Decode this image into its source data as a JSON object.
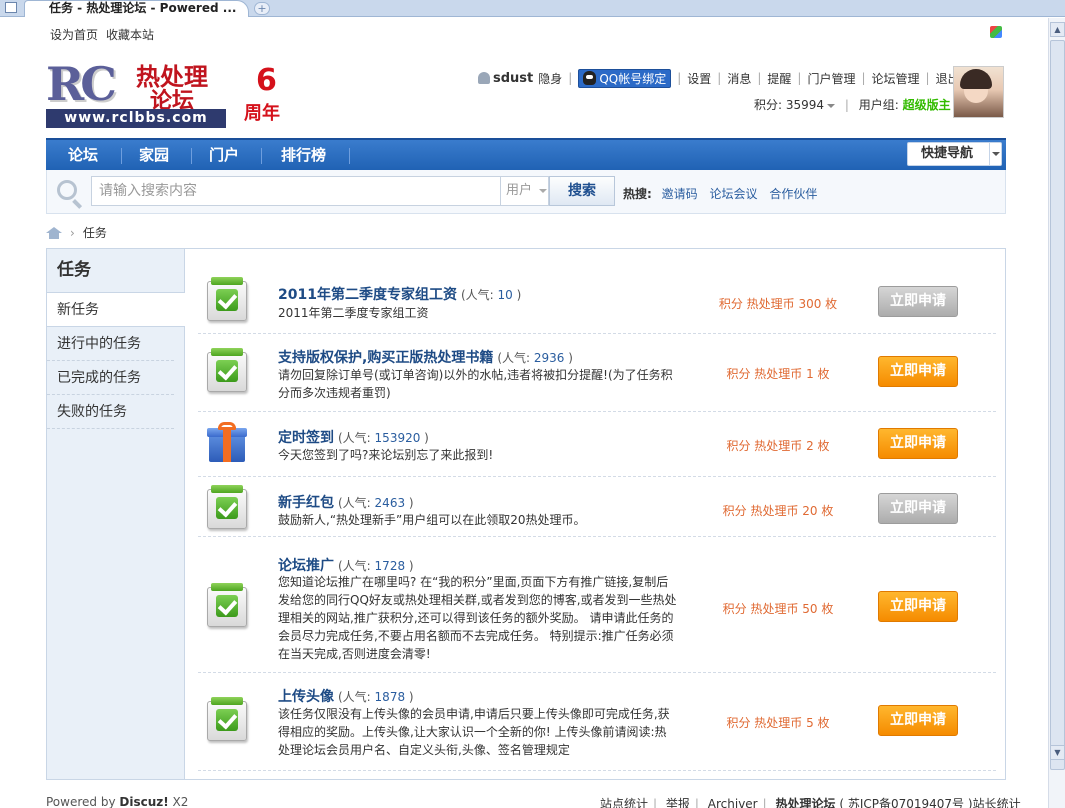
{
  "browser": {
    "tab_title": "任务 - 热处理论坛 - Powered ...",
    "newtab_label": "+"
  },
  "topbar": {
    "set_home": "设为首页",
    "bookmark": "收藏本站"
  },
  "logo": {
    "brand_letters": "RC",
    "cn_line1": "热处理",
    "cn_line2": "论坛",
    "url": "www.rclbbs.com",
    "anniversary_number": "6",
    "anniversary_unit": "周年"
  },
  "user": {
    "username": "sdust",
    "status": "隐身",
    "qq_bind": "QQ帐号绑定",
    "links": [
      "设置",
      "消息",
      "提醒",
      "门户管理",
      "论坛管理",
      "退出"
    ],
    "points_label": "积分: 35994",
    "group_label": "用户组: ",
    "group_value": "超级版主"
  },
  "nav": {
    "items": [
      "论坛",
      "家园",
      "门户",
      "排行榜"
    ],
    "quick_nav": "快捷导航"
  },
  "search": {
    "placeholder": "请输入搜索内容",
    "type": "用户",
    "button": "搜索",
    "hot_label": "热搜:",
    "hot_links": [
      "邀请码",
      "论坛会议",
      "合作伙伴"
    ]
  },
  "breadcrumb": {
    "sep": "›",
    "current": "任务"
  },
  "sidebar": {
    "title": "任务",
    "items": [
      "新任务",
      "进行中的任务",
      "已完成的任务",
      "失败的任务"
    ]
  },
  "tasks": [
    {
      "title": "2011年第二季度专家组工资",
      "pop_open": "(人气: ",
      "pop_num": "10",
      "pop_close": " )",
      "desc": "2011年第二季度专家组工资",
      "reward": "积分 热处理币 300 枚",
      "button": "立即申请",
      "enabled": false,
      "icon": "clipboard-check-icon"
    },
    {
      "title": "支持版权保护,购买正版热处理书籍",
      "pop_open": "(人气: ",
      "pop_num": "2936",
      "pop_close": " )",
      "desc": "请勿回复除订单号(或订单咨询)以外的水帖,违者将被扣分提醒!(为了任务积分而多次违规者重罚)",
      "reward": "积分 热处理币 1 枚",
      "button": "立即申请",
      "enabled": true,
      "icon": "clipboard-check-icon"
    },
    {
      "title": "定时签到",
      "pop_open": "(人气: ",
      "pop_num": "153920",
      "pop_close": " )",
      "desc": "今天您签到了吗?来论坛别忘了来此报到!",
      "reward": "积分 热处理币 2 枚",
      "button": "立即申请",
      "enabled": true,
      "icon": "gift-icon"
    },
    {
      "title": "新手红包",
      "pop_open": "(人气: ",
      "pop_num": "2463",
      "pop_close": " )",
      "desc": "鼓励新人,“热处理新手”用户组可以在此领取20热处理币。",
      "reward": "积分 热处理币 20 枚",
      "button": "立即申请",
      "enabled": false,
      "icon": "clipboard-check-icon"
    },
    {
      "title": "论坛推广",
      "pop_open": "(人气: ",
      "pop_num": "1728",
      "pop_close": " )",
      "desc": "您知道论坛推广在哪里吗? 在“我的积分”里面,页面下方有推广链接,复制后发给您的同行QQ好友或热处理相关群,或者发到您的博客,或者发到一些热处理相关的网站,推广获积分,还可以得到该任务的额外奖励。 请申请此任务的会员尽力完成任务,不要占用名额而不去完成任务。 特别提示:推广任务必须在当天完成,否则进度会清零!",
      "reward": "积分 热处理币 50 枚",
      "button": "立即申请",
      "enabled": true,
      "icon": "clipboard-check-icon"
    },
    {
      "title": "上传头像",
      "pop_open": "(人气: ",
      "pop_num": "1878",
      "pop_close": " )",
      "desc": "该任务仅限没有上传头像的会员申请,申请后只要上传头像即可完成任务,获得相应的奖励。上传头像,让大家认识一个全新的你! 上传头像前请阅读:热处理论坛会员用户名、自定义头衔,头像、签名管理规定",
      "reward": "积分 热处理币 5 枚",
      "button": "立即申请",
      "enabled": true,
      "icon": "clipboard-check-icon"
    }
  ],
  "footer": {
    "powered": "Powered by ",
    "brand": "Discuz!",
    "version": " X2",
    "links": [
      "站点统计",
      "举报",
      "Archiver"
    ],
    "site_name": "热处理论坛",
    "icp": " ( 苏ICP备07019407号 )",
    "stats": "站长统计"
  }
}
